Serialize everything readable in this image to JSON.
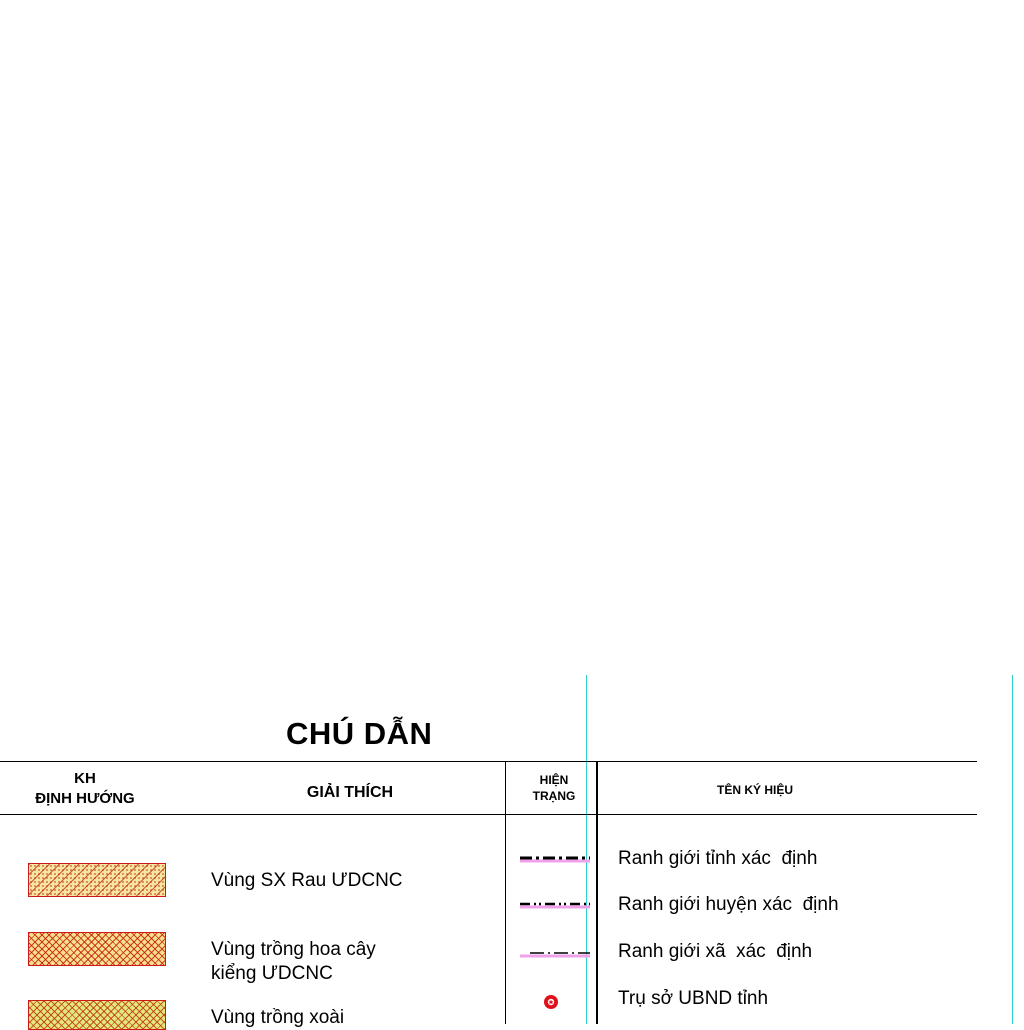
{
  "legend": {
    "title": "CHÚ DẪN",
    "headers": {
      "kh_line1": "KH",
      "kh_line2": "ĐỊNH HƯỚNG",
      "explanation": "GIẢI THÍCH",
      "current_line1": "HIỆN",
      "current_line2": "TRẠNG",
      "symbol_name": "TÊN KÝ HIỆU"
    },
    "planned_items": [
      {
        "label_line1": "Vùng SX Rau ƯDCNC",
        "label_line2": "",
        "pattern": "hatched-orange"
      },
      {
        "label_line1": "Vùng trồng hoa cây",
        "label_line2": "kiểng ƯDCNC",
        "pattern": "crosshatch-red"
      },
      {
        "label_line1": "Vùng trồng xoài",
        "label_line2": "",
        "pattern": "crosshatch-green"
      }
    ],
    "current_items": [
      {
        "name": "Ranh giới tỉnh xác  định",
        "symbol": "province-boundary-line"
      },
      {
        "name": "Ranh giới huyện xác  định",
        "symbol": "district-boundary-line"
      },
      {
        "name": "Ranh giới xã  xác  định",
        "symbol": "commune-boundary-line"
      },
      {
        "name": "Trụ sở UBND tỉnh",
        "symbol": "province-office-icon"
      }
    ],
    "colors": {
      "boundary_pink": "#f0a0e8",
      "guide_cyan": "#30d0d0",
      "office_red": "#e0101a"
    }
  }
}
